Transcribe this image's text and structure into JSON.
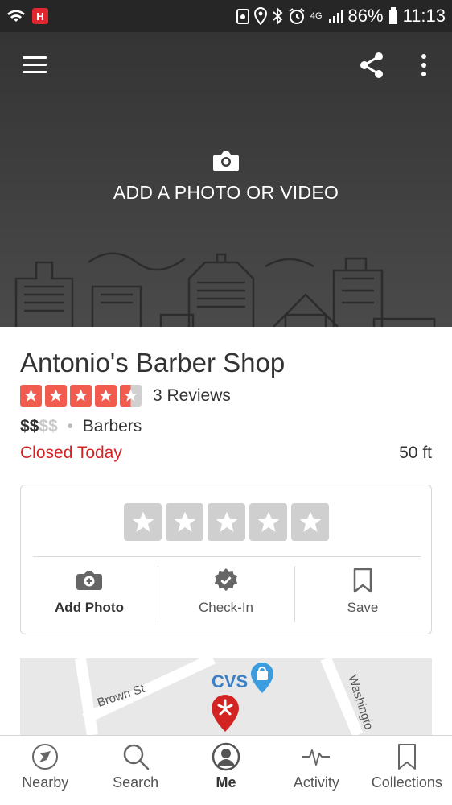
{
  "status_bar": {
    "battery": "86%",
    "time": "11:13",
    "network": "4G"
  },
  "hero": {
    "add_photo_label": "ADD A PHOTO OR VIDEO"
  },
  "business": {
    "name": "Antonio's Barber Shop",
    "rating": 4.5,
    "reviews": "3 Reviews",
    "price_active": "$$",
    "price_inactive": "$$",
    "separator": "•",
    "category": "Barbers",
    "hours_status": "Closed Today",
    "distance": "50 ft"
  },
  "actions": {
    "add_photo": "Add Photo",
    "check_in": "Check-In",
    "save": "Save"
  },
  "map": {
    "street_1": "Brown St",
    "store": "CVS",
    "street_2": "Washingto"
  },
  "bottom_nav": [
    {
      "label": "Nearby",
      "icon": "compass-icon"
    },
    {
      "label": "Search",
      "icon": "search-icon"
    },
    {
      "label": "Me",
      "icon": "profile-icon"
    },
    {
      "label": "Activity",
      "icon": "activity-icon"
    },
    {
      "label": "Collections",
      "icon": "bookmark-icon"
    }
  ],
  "colors": {
    "brand_red": "#d32323",
    "star_red": "#f15c4f",
    "hero_bg": "#3a3a3a",
    "cvs_blue": "#3b7fc4"
  }
}
